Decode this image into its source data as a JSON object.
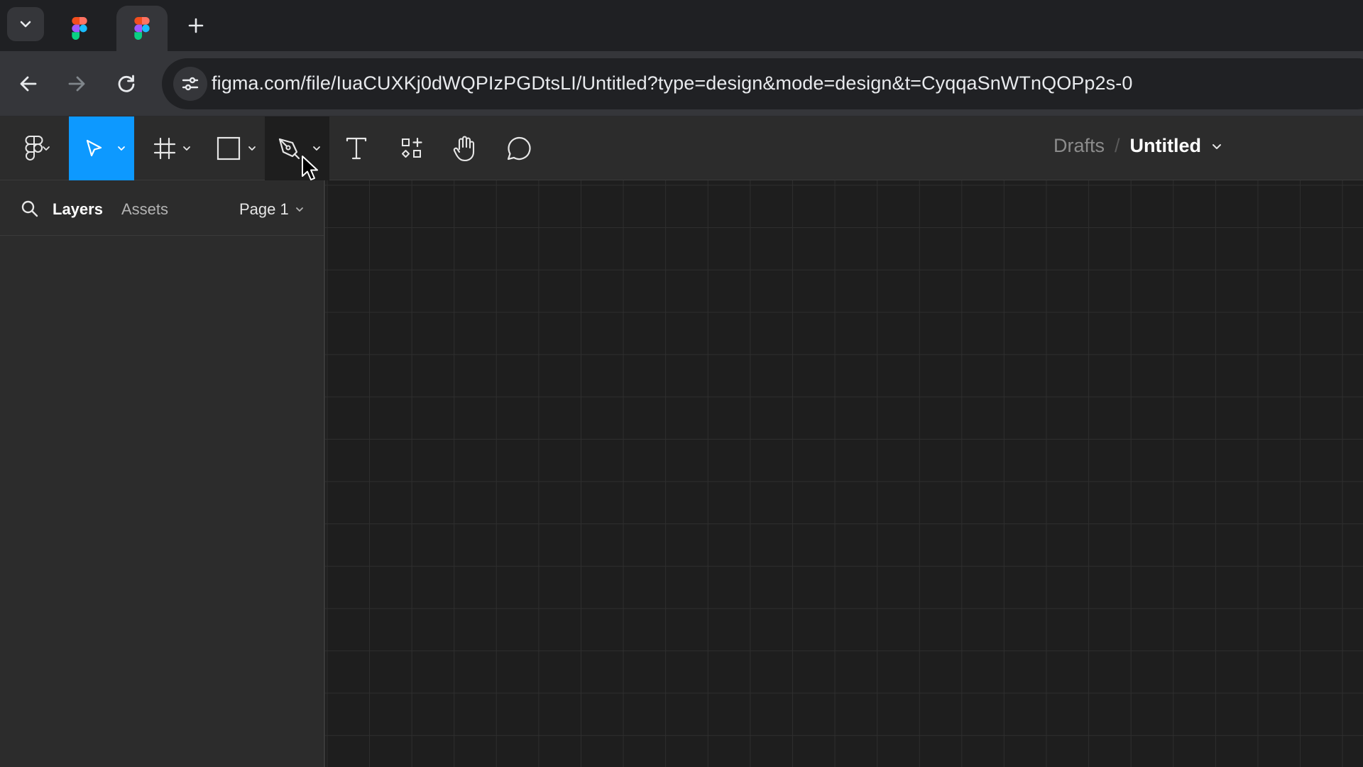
{
  "browser": {
    "tabs": [
      {
        "icon": "figma-icon",
        "active": false
      },
      {
        "icon": "figma-icon",
        "active": true
      }
    ],
    "url": "figma.com/file/IuaCUXKj0dWQPIzPGDtsLI/Untitled?type=design&mode=design&t=CyqqaSnWTnQOPp2s-0"
  },
  "toolbar": {
    "tools": [
      {
        "name": "main-menu",
        "icon": "figma-menu-icon"
      },
      {
        "name": "move",
        "icon": "move-pointer-icon",
        "state": "selected"
      },
      {
        "name": "frame",
        "icon": "frame-icon"
      },
      {
        "name": "shape",
        "icon": "rectangle-icon"
      },
      {
        "name": "pen",
        "icon": "pen-icon",
        "state": "pressed"
      },
      {
        "name": "text",
        "icon": "text-icon"
      },
      {
        "name": "resources",
        "icon": "resources-icon"
      },
      {
        "name": "hand",
        "icon": "hand-icon"
      },
      {
        "name": "comment",
        "icon": "comment-icon"
      }
    ],
    "breadcrumb": {
      "folder": "Drafts",
      "separator": "/",
      "file_title": "Untitled"
    }
  },
  "left_panel": {
    "tabs": {
      "layers": "Layers",
      "assets": "Assets"
    },
    "page_selector": "Page 1"
  },
  "colors": {
    "accent": "#0d99ff",
    "toolbar_bg": "#2c2c2c",
    "canvas_bg": "#1e1e1e"
  }
}
